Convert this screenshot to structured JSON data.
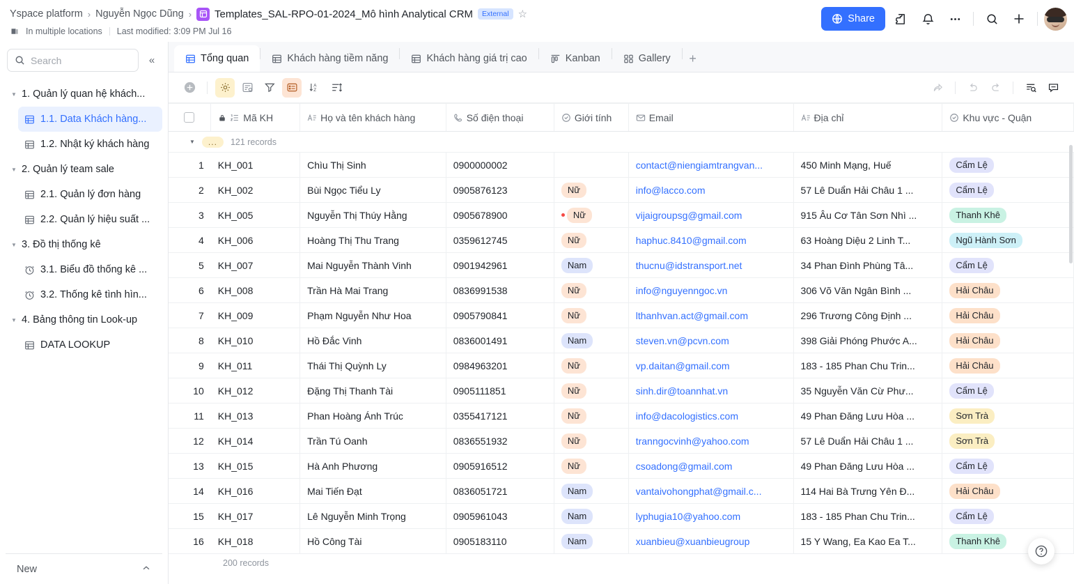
{
  "header": {
    "breadcrumbs": [
      {
        "label": "Yspace platform"
      },
      {
        "label": "Nguyễn Ngọc Dũng"
      }
    ],
    "title": "Templates_SAL-RPO-01-2024_Mô hình Analytical CRM",
    "badge": "External",
    "location": "In multiple locations",
    "last_modified": "Last modified: 3:09 PM Jul 16",
    "share_label": "Share",
    "icons": [
      "file-icon",
      "star-icon",
      "location-icon",
      "globe-icon",
      "extension-icon",
      "bell-icon",
      "more-icon",
      "search-icon",
      "plus-icon",
      "avatar"
    ]
  },
  "sidebar": {
    "search_placeholder": "Search",
    "search_value": "",
    "collapse_icon": "chevron-double-left-icon",
    "tree": [
      {
        "type": "group",
        "label": "1. Quản lý quan hệ khách..."
      },
      {
        "type": "item",
        "label": "1.1. Data Khách hàng...",
        "icon": "table-icon",
        "active": true
      },
      {
        "type": "item",
        "label": "1.2. Nhật ký khách hàng",
        "icon": "table-icon",
        "active": false
      },
      {
        "type": "group",
        "label": "2. Quản lý team sale"
      },
      {
        "type": "item",
        "label": "2.1. Quản lý đơn hàng",
        "icon": "table-icon",
        "active": false
      },
      {
        "type": "item",
        "label": "2.2. Quản lý hiệu suất ...",
        "icon": "table-icon",
        "active": false
      },
      {
        "type": "group",
        "label": "3. Đồ thị thống kê"
      },
      {
        "type": "item",
        "label": "3.1. Biểu đồ thống kê ...",
        "icon": "dashboard-icon",
        "active": false
      },
      {
        "type": "item",
        "label": "3.2. Thống kê tình hìn...",
        "icon": "dashboard-icon",
        "active": false
      },
      {
        "type": "group",
        "label": "4. Bảng thông tin Look-up"
      },
      {
        "type": "item",
        "label": "DATA LOOKUP",
        "icon": "table-icon",
        "active": false
      }
    ],
    "footer": {
      "new_label": "New",
      "chevron": "chevron-up-icon"
    }
  },
  "tabs": [
    {
      "label": "Tổng quan",
      "icon": "grid-view-icon",
      "active": true
    },
    {
      "label": "Khách hàng tiềm năng",
      "icon": "grid-view-icon",
      "active": false
    },
    {
      "label": "Khách hàng giá trị cao",
      "icon": "grid-view-icon",
      "active": false
    },
    {
      "label": "Kanban",
      "icon": "kanban-icon",
      "active": false
    },
    {
      "label": "Gallery",
      "icon": "gallery-icon",
      "active": false
    }
  ],
  "tab_add_label": "+",
  "toolbar": {
    "left": [
      {
        "name": "add-record-button",
        "icon": "plus-circle-icon",
        "highlight": "none"
      },
      {
        "name": "field-settings-button",
        "icon": "gear-icon",
        "highlight": "yellow"
      },
      {
        "name": "group-button",
        "icon": "group-icon",
        "highlight": "none"
      },
      {
        "name": "filter-button",
        "icon": "filter-icon",
        "highlight": "none"
      },
      {
        "name": "row-height-button",
        "icon": "row-height-icon",
        "highlight": "orange"
      },
      {
        "name": "sort-button",
        "icon": "sort-az-icon",
        "highlight": "none"
      },
      {
        "name": "list-settings-button",
        "icon": "list-adjust-icon",
        "highlight": "none"
      }
    ],
    "right": [
      {
        "name": "share-view-button",
        "icon": "share-arrow-icon",
        "dim": true
      },
      {
        "name": "undo-button",
        "icon": "undo-icon",
        "dim": true
      },
      {
        "name": "redo-button",
        "icon": "redo-icon",
        "dim": true
      },
      {
        "name": "search-records-button",
        "icon": "search-in-table-icon",
        "dim": false
      },
      {
        "name": "comment-button",
        "icon": "comment-icon",
        "dim": false
      }
    ]
  },
  "table": {
    "columns": [
      {
        "label": "Mã KH",
        "icon": "autonumber-icon",
        "locked": true
      },
      {
        "label": "Họ và tên khách hàng",
        "icon": "text-icon"
      },
      {
        "label": "Số điện thoại",
        "icon": "phone-icon"
      },
      {
        "label": "Giới tính",
        "icon": "select-icon"
      },
      {
        "label": "Email",
        "icon": "email-icon"
      },
      {
        "label": "Địa chỉ",
        "icon": "text-icon"
      },
      {
        "label": "Khu vực - Quận",
        "icon": "select-icon"
      }
    ],
    "group_row": {
      "dots": "...",
      "count": "121 records"
    },
    "footer_count": "200 records",
    "rows": [
      {
        "n": "1",
        "code": "KH_001",
        "name": "Chìu Thị Sinh",
        "phone": "0900000002",
        "gender": "",
        "comment": false,
        "email": "contact@niengiamtrangvan...",
        "address": "450 Minh Mạng, Huế",
        "district": "Cẩm Lệ"
      },
      {
        "n": "2",
        "code": "KH_002",
        "name": "Bùi Ngọc Tiểu Ly",
        "phone": "0905876123",
        "gender": "Nữ",
        "comment": false,
        "email": "info@lacco.com",
        "address": "57 Lê Duẩn Hải Châu 1 ...",
        "district": "Cẩm Lệ"
      },
      {
        "n": "3",
        "code": "KH_005",
        "name": "Nguyễn Thị Thúy Hằng",
        "phone": "0905678900",
        "gender": "Nữ",
        "comment": true,
        "email": "vijaigroupsg@gmail.com",
        "address": "915 Âu Cơ Tân Sơn Nhì ...",
        "district": "Thanh Khê"
      },
      {
        "n": "4",
        "code": "KH_006",
        "name": "Hoàng Thị Thu Trang",
        "phone": "0359612745",
        "gender": "Nữ",
        "comment": false,
        "email": "haphuc.8410@gmail.com",
        "address": "63 Hoàng Diệu 2 Linh T...",
        "district": "Ngũ Hành Sơn"
      },
      {
        "n": "5",
        "code": "KH_007",
        "name": "Mai Nguyễn Thành Vinh",
        "phone": "0901942961",
        "gender": "Nam",
        "comment": false,
        "email": "thucnu@idstransport.net",
        "address": "34 Phan Đình Phùng Tâ...",
        "district": "Cẩm Lệ"
      },
      {
        "n": "6",
        "code": "KH_008",
        "name": "Trần Hà Mai Trang",
        "phone": "0836991538",
        "gender": "Nữ",
        "comment": false,
        "email": "info@nguyenngoc.vn",
        "address": "306 Võ Văn Ngân Bình ...",
        "district": "Hải Châu"
      },
      {
        "n": "7",
        "code": "KH_009",
        "name": "Phạm Nguyễn Như Hoa",
        "phone": "0905790841",
        "gender": "Nữ",
        "comment": false,
        "email": "lthanhvan.act@gmail.com",
        "address": "296 Trương Công Định ...",
        "district": "Hải Châu"
      },
      {
        "n": "8",
        "code": "KH_010",
        "name": "Hồ Đắc Vinh",
        "phone": "0836001491",
        "gender": "Nam",
        "comment": false,
        "email": "steven.vn@pcvn.com",
        "address": "398 Giải Phóng Phước A...",
        "district": "Hải Châu"
      },
      {
        "n": "9",
        "code": "KH_011",
        "name": "Thái Thị Quỳnh Ly",
        "phone": "0984963201",
        "gender": "Nữ",
        "comment": false,
        "email": "vp.daitan@gmail.com",
        "address": "183 - 185 Phan Chu Trin...",
        "district": "Hải Châu"
      },
      {
        "n": "10",
        "code": "KH_012",
        "name": "Đặng Thị Thanh Tài",
        "phone": "0905111851",
        "gender": "Nữ",
        "comment": false,
        "email": "sinh.dir@toannhat.vn",
        "address": "35 Nguyễn Văn Cừ Phư...",
        "district": "Cẩm Lệ"
      },
      {
        "n": "11",
        "code": "KH_013",
        "name": "Phan Hoàng Ánh Trúc",
        "phone": "0355417121",
        "gender": "Nữ",
        "comment": false,
        "email": "info@dacologistics.com",
        "address": "49 Phan Đăng Lưu Hòa ...",
        "district": "Sơn Trà"
      },
      {
        "n": "12",
        "code": "KH_014",
        "name": "Trần Tú Oanh",
        "phone": "0836551932",
        "gender": "Nữ",
        "comment": false,
        "email": "tranngocvinh@yahoo.com",
        "address": "57 Lê Duẩn Hải Châu 1 ...",
        "district": "Sơn Trà"
      },
      {
        "n": "13",
        "code": "KH_015",
        "name": "Hà Anh Phương",
        "phone": "0905916512",
        "gender": "Nữ",
        "comment": false,
        "email": "csoadong@gmail.com",
        "address": "49 Phan Đăng Lưu Hòa ...",
        "district": "Cẩm Lệ"
      },
      {
        "n": "14",
        "code": "KH_016",
        "name": "Mai Tiến Đạt",
        "phone": "0836051721",
        "gender": "Nam",
        "comment": false,
        "email": "vantaivohongphat@gmail.c...",
        "address": "114 Hai Bà Trưng Yên Đ...",
        "district": "Hải Châu"
      },
      {
        "n": "15",
        "code": "KH_017",
        "name": "Lê Nguyễn Minh Trọng",
        "phone": "0905961043",
        "gender": "Nam",
        "comment": false,
        "email": "lyphugia10@yahoo.com",
        "address": "183 - 185 Phan Chu Trin...",
        "district": "Cẩm Lệ"
      },
      {
        "n": "16",
        "code": "KH_018",
        "name": "Hồ Công Tài",
        "phone": "0905183110",
        "gender": "Nam",
        "comment": false,
        "email": "xuanbieu@xuanbieugroup",
        "address": "15 Y Wang, Ea Kao Ea T...",
        "district": "Thanh Khê"
      }
    ]
  },
  "colors": {
    "accent": "#3370ff",
    "gender_female_bg": "#fde4d4",
    "gender_male_bg": "#dde4fb",
    "district_cam_le": "#e1e3fb",
    "district_thanh_khe": "#c9f2e3",
    "district_ngu_hanh_son": "#cdf0f7",
    "district_hai_chau": "#fde0c9",
    "district_son_tra": "#fbeec2",
    "highlight_yellow": "#fdf1cd",
    "highlight_orange": "#fde4d4"
  },
  "help_button": {
    "icon": "help-icon",
    "label": "?"
  }
}
